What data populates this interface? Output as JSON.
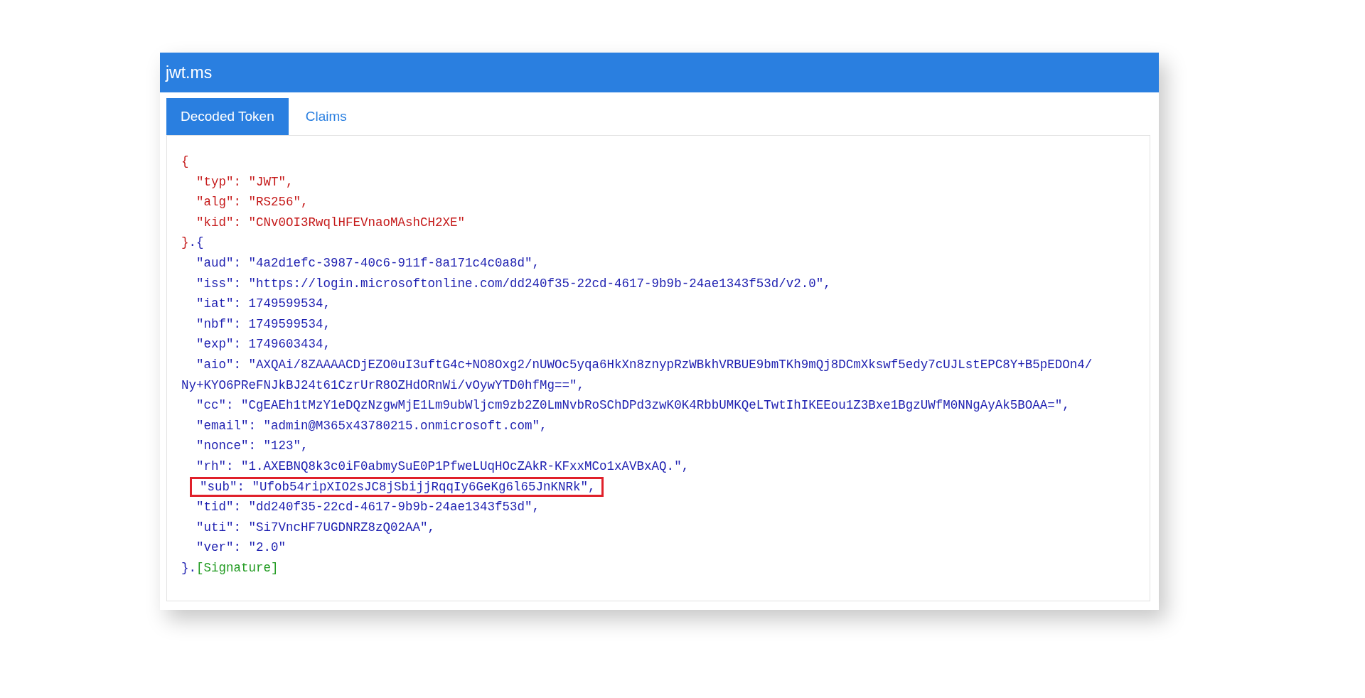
{
  "window": {
    "title": "jwt.ms"
  },
  "tabs": [
    {
      "label": "Decoded Token",
      "selected": true
    },
    {
      "label": "Claims",
      "selected": false
    }
  ],
  "token_lines": [
    {
      "highlighted": false,
      "parts": [
        {
          "text": "{",
          "kind": "header"
        }
      ]
    },
    {
      "highlighted": false,
      "parts": [
        {
          "text": "  \"typ\": \"JWT\",",
          "kind": "header"
        }
      ]
    },
    {
      "highlighted": false,
      "parts": [
        {
          "text": "  \"alg\": \"RS256\",",
          "kind": "header"
        }
      ]
    },
    {
      "highlighted": false,
      "parts": [
        {
          "text": "  \"kid\": \"CNv0OI3RwqlHFEVnaoMAshCH2XE\"",
          "kind": "header"
        }
      ]
    },
    {
      "highlighted": false,
      "parts": [
        {
          "text": "}",
          "kind": "header"
        },
        {
          "text": ".{",
          "kind": "payload"
        }
      ]
    },
    {
      "highlighted": false,
      "parts": [
        {
          "text": "  \"aud\": \"4a2d1efc-3987-40c6-911f-8a171c4c0a8d\",",
          "kind": "payload"
        }
      ]
    },
    {
      "highlighted": false,
      "parts": [
        {
          "text": "  \"iss\": \"https://login.microsoftonline.com/dd240f35-22cd-4617-9b9b-24ae1343f53d/v2.0\",",
          "kind": "payload"
        }
      ]
    },
    {
      "highlighted": false,
      "parts": [
        {
          "text": "  \"iat\": 1749599534,",
          "kind": "payload"
        }
      ]
    },
    {
      "highlighted": false,
      "parts": [
        {
          "text": "  \"nbf\": 1749599534,",
          "kind": "payload"
        }
      ]
    },
    {
      "highlighted": false,
      "parts": [
        {
          "text": "  \"exp\": 1749603434,",
          "kind": "payload"
        }
      ]
    },
    {
      "highlighted": false,
      "parts": [
        {
          "text": "  \"aio\": \"AXQAi/8ZAAAACDjEZO0uI3uftG4c+NO8Oxg2/nUWOc5yqa6HkXn8znypRzWBkhVRBUE9bmTKh9mQj8DCmXkswf5edy7cUJLstEPC8Y+B5pEDOn4/Ny+KYO6PReFNJkBJ24t61CzrUrR8OZHdORnWi/vOywYTD0hfMg==\",",
          "kind": "payload"
        }
      ]
    },
    {
      "highlighted": false,
      "parts": [
        {
          "text": "  \"cc\": \"CgEAEh1tMzY1eDQzNzgwMjE1Lm9ubWljcm9zb2Z0LmNvbRoSChDPd3zwK0K4RbbUMKQeLTwtIhIKEEou1Z3Bxe1BgzUWfM0NNgAyAk5BOAA=\",",
          "kind": "payload"
        }
      ]
    },
    {
      "highlighted": false,
      "parts": [
        {
          "text": "  \"email\": \"admin@M365x43780215.onmicrosoft.com\",",
          "kind": "payload"
        }
      ]
    },
    {
      "highlighted": false,
      "parts": [
        {
          "text": "  \"nonce\": \"123\",",
          "kind": "payload"
        }
      ]
    },
    {
      "highlighted": false,
      "parts": [
        {
          "text": "  \"rh\": \"1.AXEBNQ8k3c0iF0abmySuE0P1PfweLUqHOcZAkR-KFxxMCo1xAVBxAQ.\",",
          "kind": "payload"
        }
      ]
    },
    {
      "highlighted": true,
      "parts": [
        {
          "text": "  \"sub\": \"Ufob54ripXIO2sJC8jSbijjRqqIy6GeKg6l65JnKNRk\",",
          "kind": "payload"
        }
      ]
    },
    {
      "highlighted": false,
      "parts": [
        {
          "text": "  \"tid\": \"dd240f35-22cd-4617-9b9b-24ae1343f53d\",",
          "kind": "payload"
        }
      ]
    },
    {
      "highlighted": false,
      "parts": [
        {
          "text": "  \"uti\": \"Si7VncHF7UGDNRZ8zQ02AA\",",
          "kind": "payload"
        }
      ]
    },
    {
      "highlighted": false,
      "parts": [
        {
          "text": "  \"ver\": \"2.0\"",
          "kind": "payload"
        }
      ]
    },
    {
      "highlighted": false,
      "parts": [
        {
          "text": "}.",
          "kind": "payload"
        },
        {
          "text": "[Signature]",
          "kind": "signature"
        }
      ]
    }
  ]
}
